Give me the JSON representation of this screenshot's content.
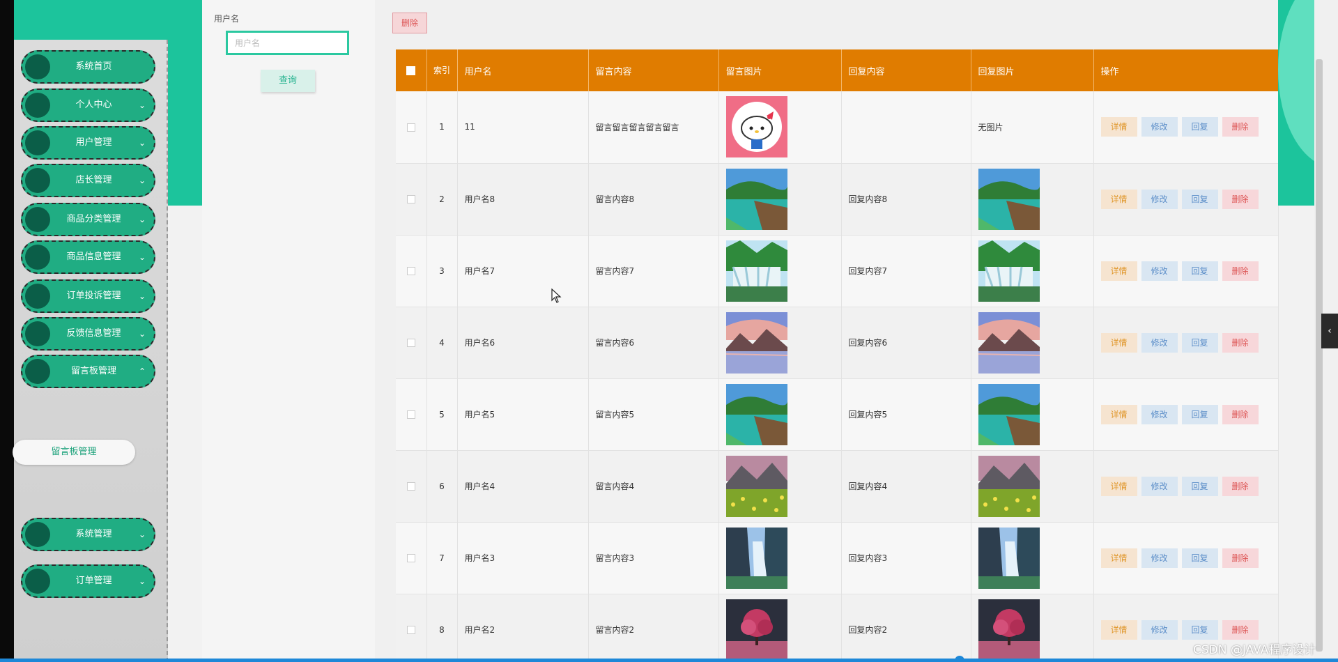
{
  "sidebar": {
    "items": [
      {
        "label": "系统首页",
        "expandable": false
      },
      {
        "label": "个人中心",
        "expandable": true,
        "chevron": "chevron-down-icon"
      },
      {
        "label": "用户管理",
        "expandable": true,
        "chevron": "chevron-down-icon"
      },
      {
        "label": "店长管理",
        "expandable": true,
        "chevron": "chevron-down-icon"
      },
      {
        "label": "商品分类管理",
        "expandable": true,
        "chevron": "chevron-down-icon"
      },
      {
        "label": "商品信息管理",
        "expandable": true,
        "chevron": "chevron-down-icon"
      },
      {
        "label": "订单投诉管理",
        "expandable": true,
        "chevron": "chevron-down-icon"
      },
      {
        "label": "反馈信息管理",
        "expandable": true,
        "chevron": "chevron-down-icon"
      },
      {
        "label": "留言板管理",
        "expandable": true,
        "chevron": "chevron-up-icon"
      },
      {
        "label": "系统管理",
        "expandable": true,
        "chevron": "chevron-down-icon"
      },
      {
        "label": "订单管理",
        "expandable": true,
        "chevron": "chevron-down-icon"
      }
    ],
    "submenu_label": "留言板管理"
  },
  "search": {
    "field_label": "用户名",
    "placeholder": "用户名",
    "value": "",
    "query_label": "查询"
  },
  "toolbar": {
    "batch_delete_label": "删除"
  },
  "table": {
    "headers": {
      "index": "索引",
      "username": "用户名",
      "message": "留言内容",
      "message_image": "留言图片",
      "reply": "回复内容",
      "reply_image": "回复图片",
      "actions": "操作"
    },
    "rows": [
      {
        "index": "1",
        "username": "11",
        "message": "留言留言留言留言留言",
        "message_image": "hello-kitty-image",
        "reply": "",
        "reply_image": "无图片"
      },
      {
        "index": "2",
        "username": "用户名8",
        "message": "留言内容8",
        "message_image": "lake-pier-image",
        "reply": "回复内容8",
        "reply_image": "lake-pier-image"
      },
      {
        "index": "3",
        "username": "用户名7",
        "message": "留言内容7",
        "message_image": "waterfall-forest-image",
        "reply": "回复内容7",
        "reply_image": "waterfall-forest-image"
      },
      {
        "index": "4",
        "username": "用户名6",
        "message": "留言内容6",
        "message_image": "mountain-lake-sunset-image",
        "reply": "回复内容6",
        "reply_image": "mountain-lake-sunset-image"
      },
      {
        "index": "5",
        "username": "用户名5",
        "message": "留言内容5",
        "message_image": "lake-pier-image",
        "reply": "回复内容5",
        "reply_image": "lake-pier-image"
      },
      {
        "index": "6",
        "username": "用户名4",
        "message": "留言内容4",
        "message_image": "mountain-meadow-image",
        "reply": "回复内容4",
        "reply_image": "mountain-meadow-image"
      },
      {
        "index": "7",
        "username": "用户名3",
        "message": "留言内容3",
        "message_image": "cliff-waterfall-image",
        "reply": "回复内容3",
        "reply_image": "cliff-waterfall-image"
      },
      {
        "index": "8",
        "username": "用户名2",
        "message": "留言内容2",
        "message_image": "pink-tree-image",
        "reply": "回复内容2",
        "reply_image": "pink-tree-image"
      }
    ],
    "actions": {
      "detail": "详情",
      "edit": "修改",
      "reply": "回复",
      "delete": "删除"
    }
  },
  "watermark": "CSDN @JAVA程序设计",
  "colors": {
    "brand_teal": "#1cc49c",
    "menu_green": "#20ad83",
    "header_orange": "#e07c00"
  }
}
